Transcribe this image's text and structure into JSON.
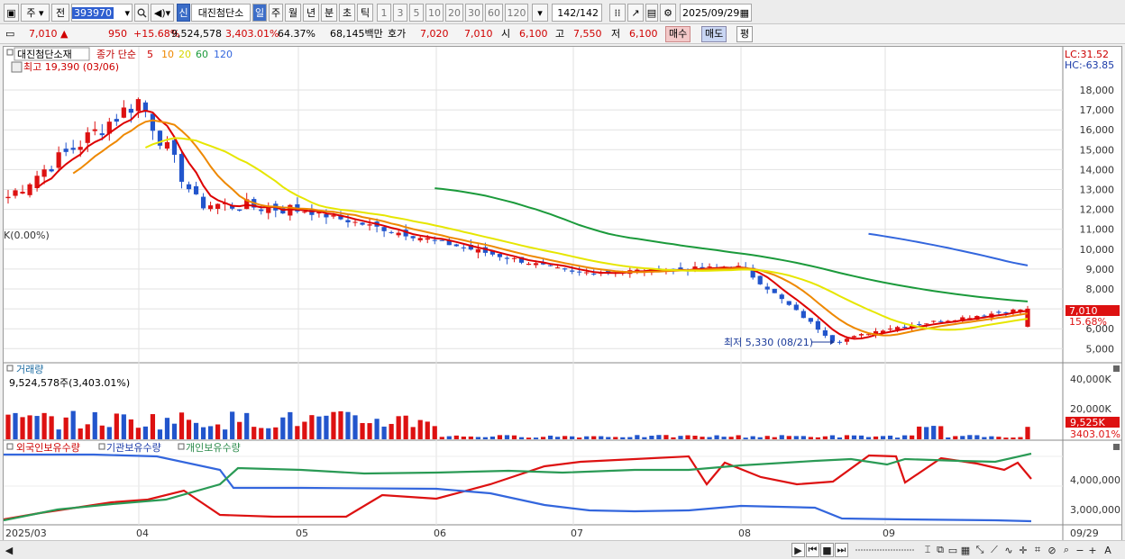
{
  "toolbar": {
    "market_type": "주",
    "scope": "전",
    "stock_code": "393970",
    "new_badge": "신",
    "stock_name": "대진첨단소",
    "period_tabs": [
      "일",
      "주",
      "월",
      "년",
      "분",
      "초",
      "틱"
    ],
    "active_period": "일",
    "interval_buttons": [
      "1",
      "3",
      "5",
      "10",
      "20",
      "30",
      "60",
      "120"
    ],
    "count_display": "142",
    "count_total": "/142",
    "date": "2025/09/29"
  },
  "quote": {
    "price": "7,010",
    "change": "950",
    "change_pct": "+15.68%",
    "volume": "9,524,578",
    "volume_ratio": "3,403.01%",
    "turnover_ratio": "64.37%",
    "trade_amount": "68,145백만",
    "bid_label": "호가",
    "bid": "7,020",
    "ask": "7,010",
    "open_label": "시",
    "open": "6,100",
    "high_label": "고",
    "high": "7,550",
    "low_label": "저",
    "low": "6,100",
    "buy_button": "매수",
    "sell_button": "매도",
    "eval_button": "평"
  },
  "price_panel": {
    "stock_label": "대진첨단소재",
    "ma_label": "종가 단순",
    "ma_periods": [
      "5",
      "10",
      "20",
      "60",
      "120"
    ],
    "ma_colors": [
      "#dd0000",
      "#ee8800",
      "#e6e600",
      "#1b9a3b",
      "#3366dd"
    ],
    "high_note": "최고 19,390 (03/06)",
    "low_note": "최저 5,330 (08/21)",
    "left_note": "K(0.00%)",
    "lc": "LC:31.52",
    "hc": "HC:-63.85",
    "y_ticks": [
      "18,000",
      "17,000",
      "16,000",
      "15,000",
      "14,000",
      "13,000",
      "12,000",
      "11,000",
      "10,000",
      "9,000",
      "8,000",
      "7,000",
      "6,000",
      "5,000"
    ],
    "last_price_tag": "7,010",
    "last_change_tag": "15.68%"
  },
  "volume_panel": {
    "title": "거래량",
    "value_note": "9,524,578주(3,403.01%)",
    "y_ticks": [
      "40,000K",
      "20,000K"
    ],
    "last_tag": "9,525K",
    "last_ratio": "3403.01%"
  },
  "holding_panel": {
    "legend": [
      "외국인보유수량",
      "기관보유수량",
      "개인보유수량"
    ],
    "colors": [
      "#dd1111",
      "#3366dd",
      "#2a9a55"
    ],
    "y_ticks": [
      "4,000,000",
      "3,000,000"
    ]
  },
  "x_axis": {
    "labels": [
      "2025/03",
      "04",
      "05",
      "06",
      "07",
      "08",
      "09"
    ],
    "right_label": "09/29"
  },
  "chart_data": {
    "type": "candlestick",
    "period": "daily",
    "y_range": [
      4600,
      19400
    ],
    "moving_averages": [
      "5",
      "10",
      "20",
      "60",
      "120"
    ],
    "close_anchors": [
      {
        "x": "03",
        "y": 12600
      },
      {
        "x": "03/06",
        "y": 13500
      },
      {
        "x": "04",
        "y": 17500
      },
      {
        "x": "04 mid",
        "y": 12300
      },
      {
        "x": "05",
        "y": 12000
      },
      {
        "x": "06",
        "y": 10400
      },
      {
        "x": "07",
        "y": 8800
      },
      {
        "x": "08",
        "y": 9100
      },
      {
        "x": "08/21",
        "y": 5330
      },
      {
        "x": "09",
        "y": 6000
      },
      {
        "x": "09/29",
        "y": 7010
      }
    ],
    "volume_series": "daily volume bars, last 9,525K",
    "holding_series": [
      "외국인보유수량",
      "기관보유수량",
      "개인보유수량"
    ]
  },
  "status": {
    "nav_buttons": [
      "▶",
      "⏮",
      "■",
      "⏭"
    ]
  }
}
